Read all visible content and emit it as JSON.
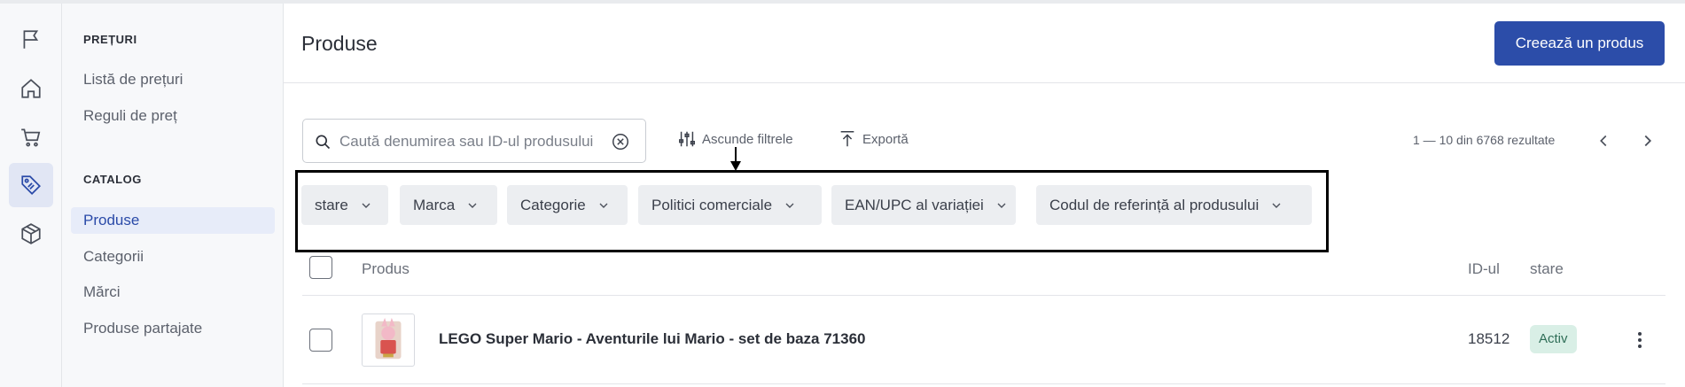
{
  "rail": {
    "icons": [
      "flag-icon",
      "home-icon",
      "cart-icon",
      "tag-icon",
      "box-icon"
    ],
    "active": "tag-icon"
  },
  "subnav": {
    "section_pricing": "PREȚURI",
    "pricing_items": [
      "Listă de prețuri",
      "Reguli de preț"
    ],
    "section_catalog": "CATALOG",
    "catalog_items": [
      "Produse",
      "Categorii",
      "Mărci",
      "Produse partajate"
    ],
    "active_item": "Produse"
  },
  "header": {
    "title": "Produse",
    "create_label": "Creează un produs"
  },
  "toolbar": {
    "search_placeholder": "Caută denumirea sau ID-ul produsului",
    "hide_filters_label": "Ascunde filtrele",
    "export_label": "Exportă",
    "results_text": "1 — 10 din 6768 rezultate"
  },
  "filters": [
    "stare",
    "Marca",
    "Categorie",
    "Politici comerciale",
    "EAN/UPC al variației",
    "Codul de referință al produsului"
  ],
  "table": {
    "columns": {
      "product": "Produs",
      "id": "ID-ul",
      "status": "stare"
    },
    "rows": [
      {
        "name": "LEGO Super Mario - Aventurile lui Mario - set de baza 71360",
        "id": "18512",
        "status": "Activ"
      }
    ]
  },
  "colors": {
    "primary": "#2c4da9",
    "active_badge_bg": "#d9efe6",
    "active_badge_text": "#2f6e57",
    "annotation": "#000000"
  }
}
